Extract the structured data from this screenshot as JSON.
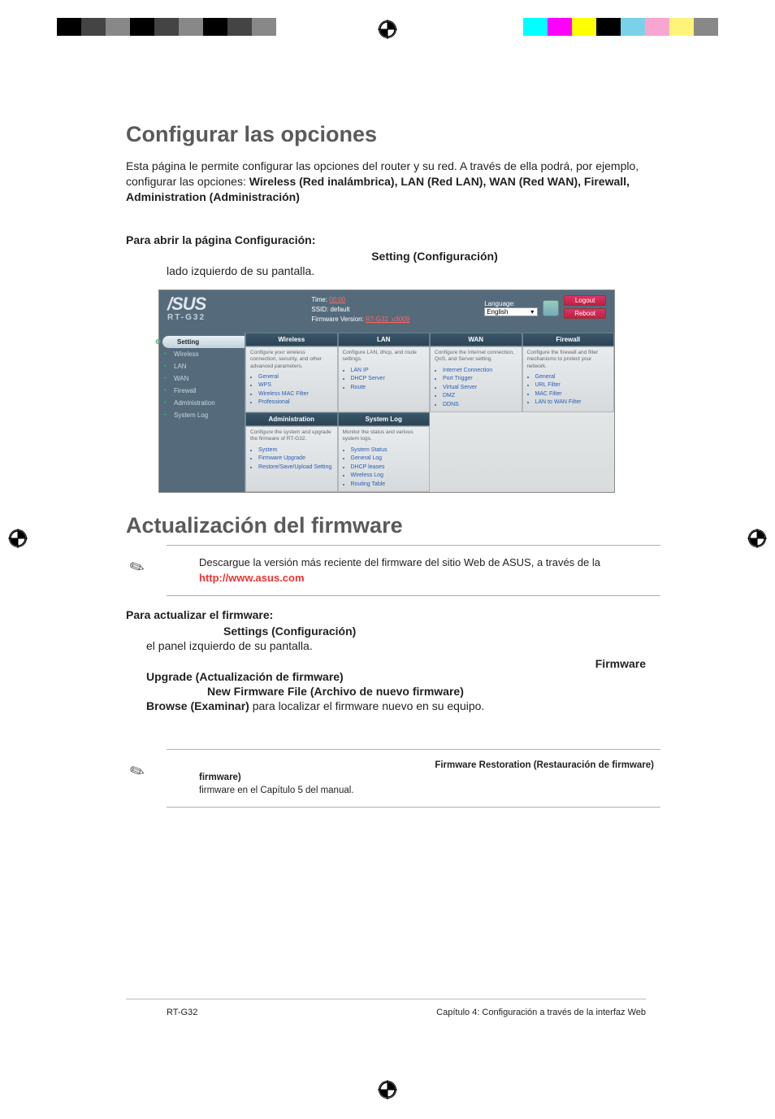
{
  "page": {
    "h1": "Configurar las opciones",
    "intro_plain": "Esta página le permite configurar las opciones del router y su red. A través de ella podrá, por ejemplo, configurar las opciones: ",
    "intro_bold": "Wireless (Red inalámbrica), LAN (Red LAN), WAN (Red WAN), Firewall, Administration (Administración)",
    "open_heading": "Para abrir la página Configuración:",
    "open_step_bold": "Setting (Configuración)",
    "open_step_tail": "lado izquierdo de su pantalla."
  },
  "screenshot": {
    "logo": "/SUS",
    "model": "RT-G32",
    "time_label": "Time: ",
    "time_value": "00:00",
    "ssid_label": "SSID: ",
    "ssid_value": "default",
    "fw_label": "Firmware Version: ",
    "fw_value": "RT-G32_v3009",
    "lang_label": "Language:",
    "lang_value": "English",
    "logout_btn": "Logout",
    "reboot_btn": "Reboot",
    "sidebar": {
      "setting": "Setting",
      "items": [
        "Wireless",
        "LAN",
        "WAN",
        "Firewall",
        "Administration",
        "System Log"
      ]
    },
    "tiles": {
      "wireless": {
        "head": "Wireless",
        "desc": "Configure your wireless connection, security, and other advanced parameters.",
        "links": [
          "General",
          "WPS",
          "Wireless MAC Filter",
          "Professional"
        ]
      },
      "lan": {
        "head": "LAN",
        "desc": "Configure LAN, dhcp, and route settings.",
        "links": [
          "LAN IP",
          "DHCP Server",
          "Route"
        ]
      },
      "wan": {
        "head": "WAN",
        "desc": "Configure the Internet connection, QoS, and Server setting.",
        "links": [
          "Internet Connection",
          "Port Trigger",
          "Virtual Server",
          "DMZ",
          "DDNS"
        ]
      },
      "firewall": {
        "head": "Firewall",
        "desc": "Configure the firewall and filter mechanisms to protect your network.",
        "links": [
          "General",
          "URL Filter",
          "MAC Filter",
          "LAN to WAN Filter"
        ]
      },
      "admin": {
        "head": "Administration",
        "desc": "Configure the system and upgrade the firmware of RT-G32.",
        "links": [
          "System",
          "Firmware Upgrade",
          "Restore/Save/Upload Setting"
        ]
      },
      "syslog": {
        "head": "System Log",
        "desc": "Monitor the status and various system logs.",
        "links": [
          "System Status",
          "General Log",
          "DHCP leases",
          "Wireless Log",
          "Routing Table"
        ]
      }
    }
  },
  "firmware": {
    "h2": "Actualización del firmware",
    "note1_text": "Descargue la versión más reciente del firmware del sitio Web de ASUS, a través de la",
    "note1_link": "http://www.asus.com",
    "update_heading": "Para actualizar el firmware:",
    "step1_bold": "Settings (Configuración)",
    "step1_tail": "el panel izquierdo de su pantalla.",
    "step2_right": "Firmware",
    "step2_bold": "Upgrade (Actualización de firmware)",
    "step3_bold": "New Firmware File (Archivo de nuevo firmware)",
    "step3_browse": "Browse (Examinar)",
    "step3_tail": " para localizar el firmware nuevo en su equipo.",
    "note2_bold": "Firmware Restoration (Restauración de firmware)",
    "note2_fw_word": "firmware)",
    "note2_tail": "firmware en el Capítulo 5 del manual."
  },
  "footer": {
    "left": "RT-G32",
    "right": "Capítulo 4: Configuración a través de la interfaz Web"
  }
}
